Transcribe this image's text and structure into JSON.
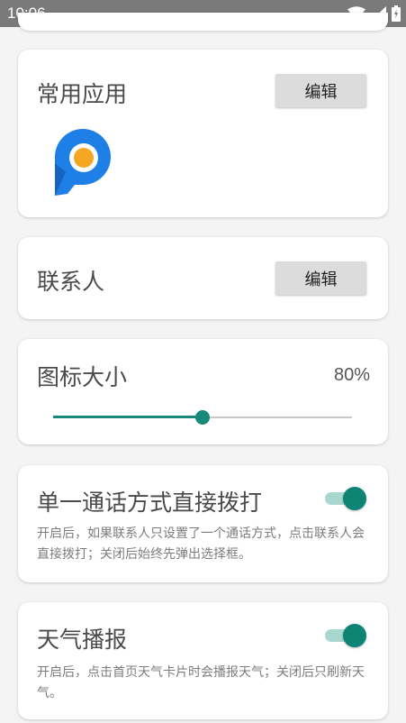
{
  "status_bar": {
    "time": "10:06"
  },
  "frequent_apps": {
    "title": "常用应用",
    "edit_label": "编辑"
  },
  "contacts": {
    "title": "联系人",
    "edit_label": "编辑"
  },
  "icon_size": {
    "title": "图标大小",
    "value_label": "80%",
    "slider_fraction": 0.5
  },
  "direct_dial": {
    "title": "单一通话方式直接拨打",
    "description": "开启后，如果联系人只设置了一个通话方式，点击联系人会直接拨打；关闭后始终先弹出选择框。",
    "enabled": true
  },
  "weather_broadcast": {
    "title": "天气播报",
    "description": "开启后，点击首页天气卡片时会播报天气；关闭后只刷新天气。",
    "enabled": true
  },
  "colors": {
    "accent": "#0e8475",
    "accent_light": "#a7d7cf",
    "app_icon_blue": "#1e7fe6",
    "app_icon_orange": "#f5a623"
  }
}
